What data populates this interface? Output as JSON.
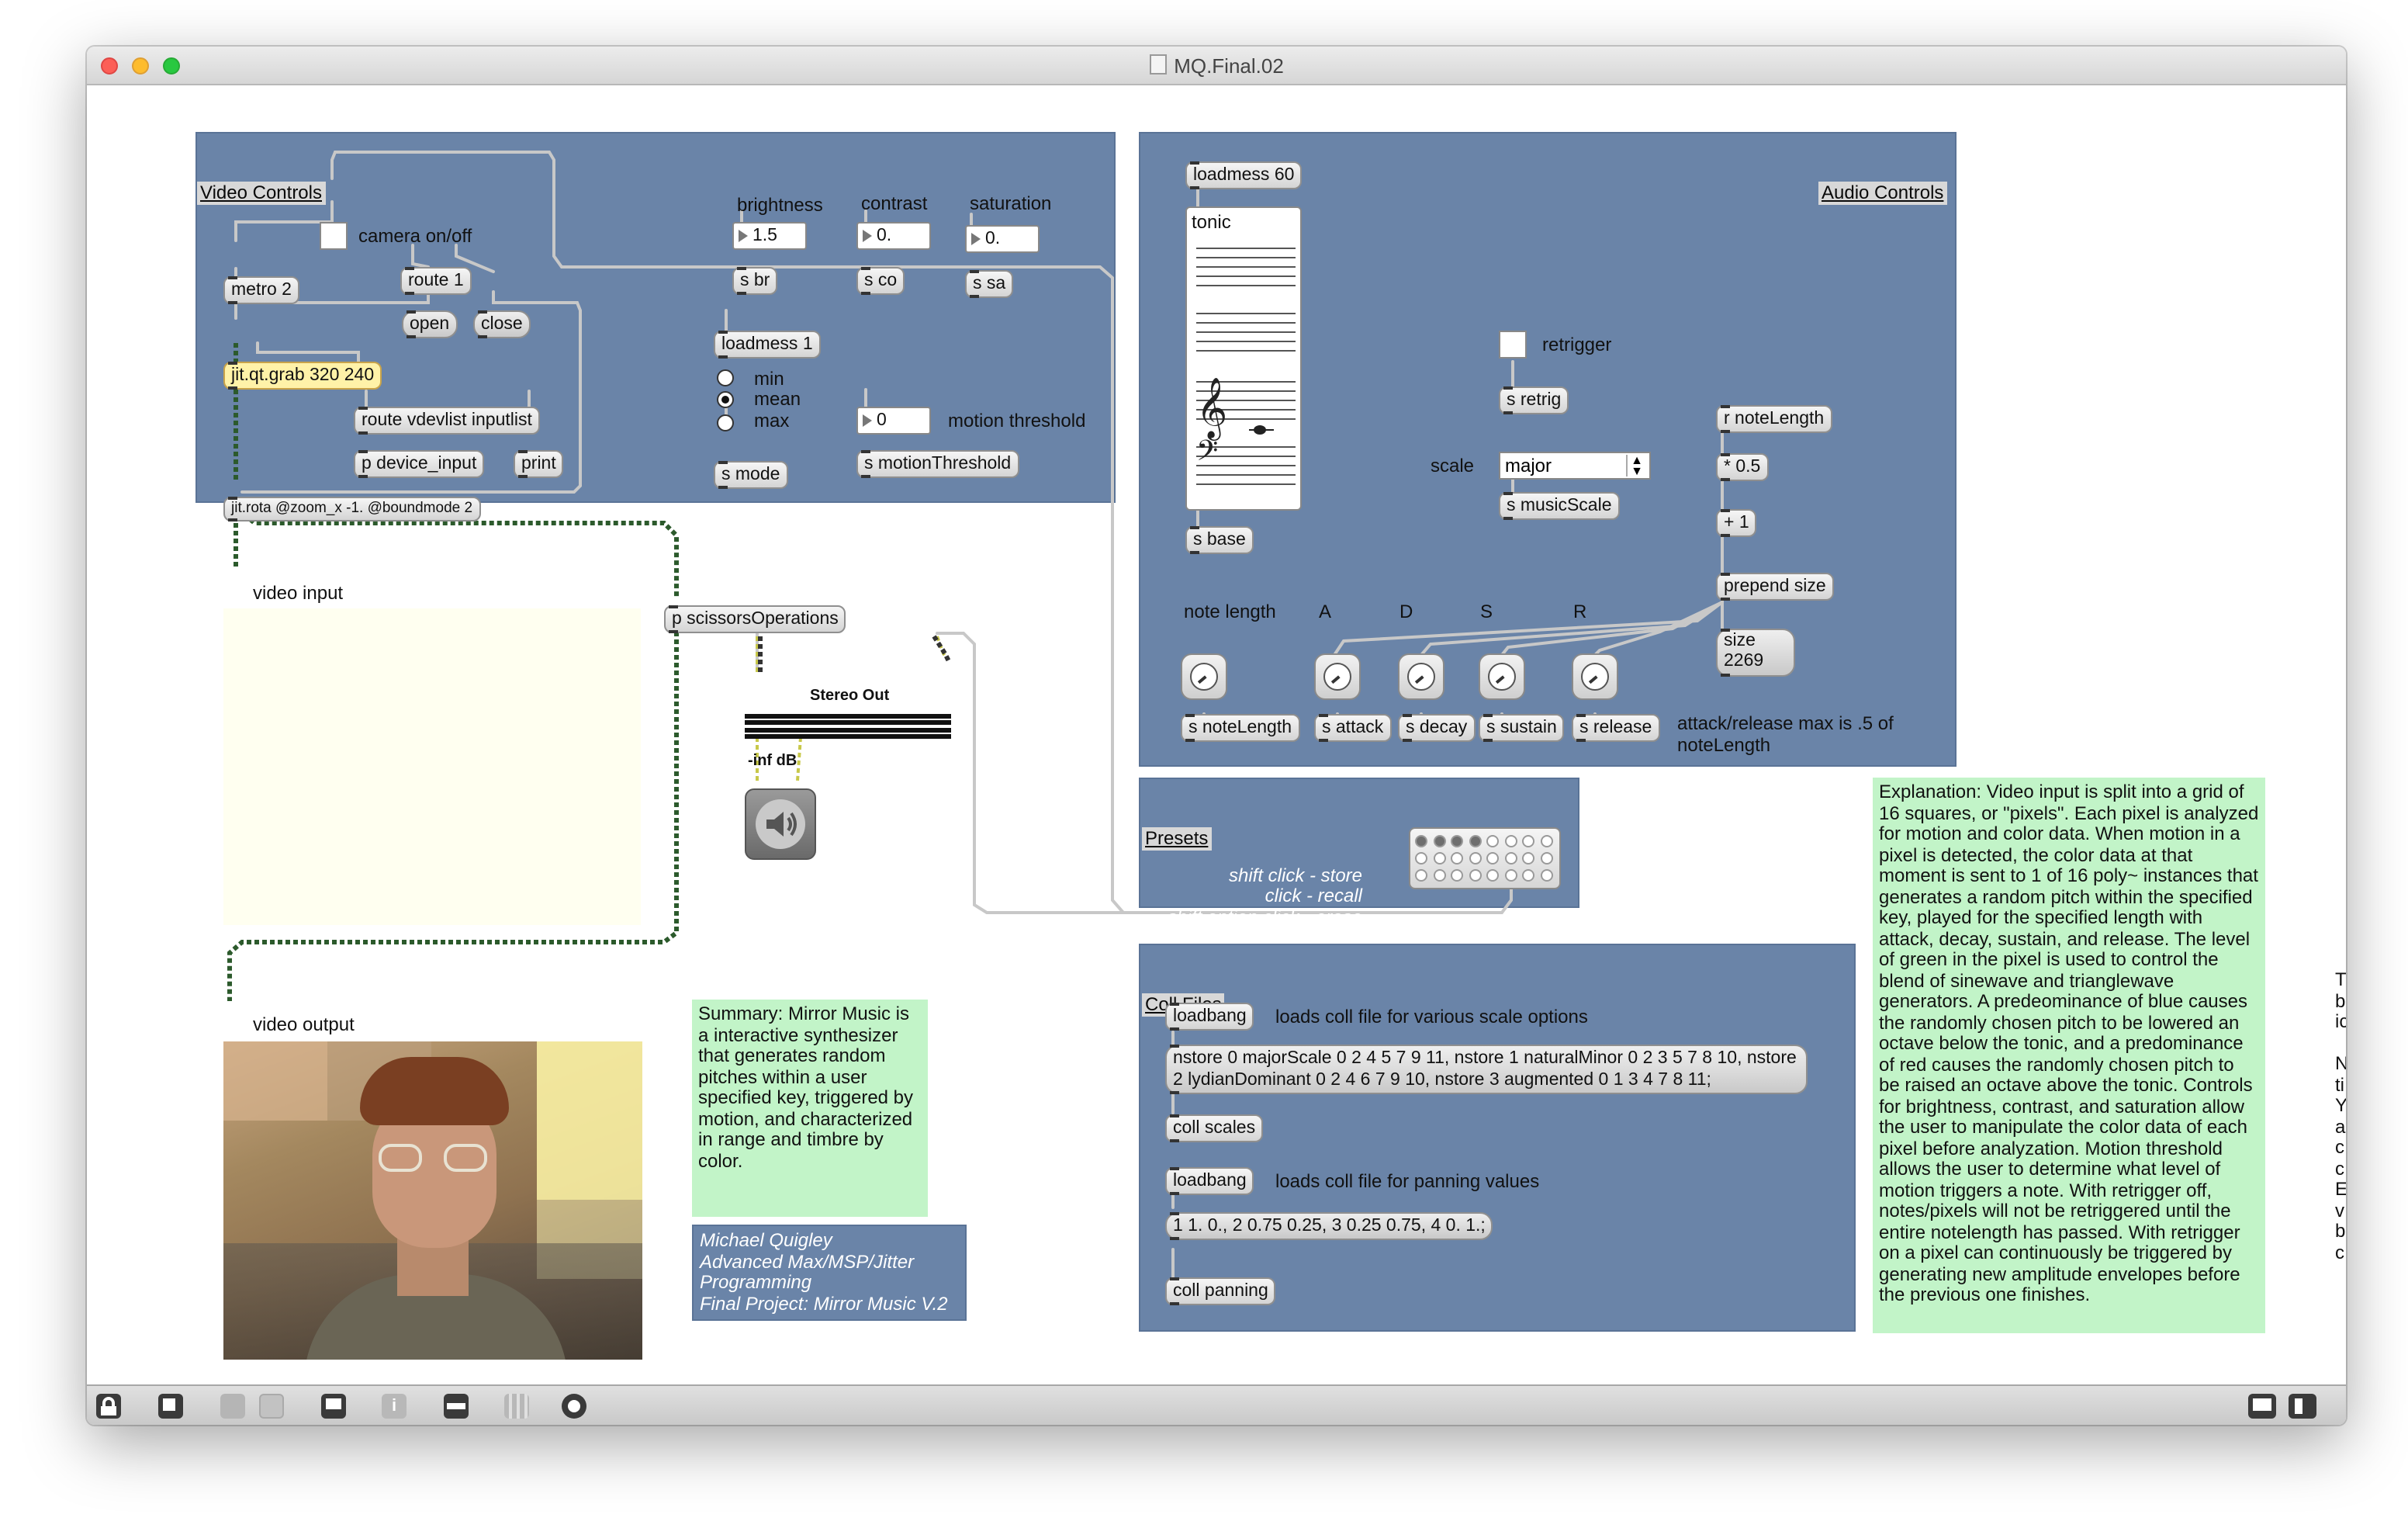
{
  "window": {
    "title": "MQ.Final.02"
  },
  "video_controls": {
    "title": "Video Controls",
    "camera_label": "camera on/off",
    "metro": "metro 2",
    "route1": "route 1",
    "open": "open",
    "close": "close",
    "grab": "jit.qt.grab 320 240",
    "route_vdev": "route vdevlist inputlist",
    "p_device": "p device_input",
    "print": "print",
    "rota": "jit.rota @zoom_x -1. @boundmode 2",
    "brightness_label": "brightness",
    "contrast_label": "contrast",
    "saturation_label": "saturation",
    "brightness_value": "1.5",
    "contrast_value": "0.",
    "saturation_value": "0.",
    "s_br": "s br",
    "s_co": "s co",
    "s_sa": "s sa",
    "loadmess": "loadmess 1",
    "mode_options": [
      "min",
      "mean",
      "max"
    ],
    "mode_selected": "mean",
    "s_mode": "s mode",
    "motion_value": "0",
    "motion_label": "motion threshold",
    "s_motion": "s motionThreshold"
  },
  "video_input_label": "video input",
  "scissors": "p scissorsOperations",
  "stereo": {
    "title": "Stereo Out",
    "level": "-inf dB",
    "icon": "speaker-icon"
  },
  "video_output_label": "video output",
  "summary": "Summary: Mirror Music is a interactive synthesizer that generates random pitches within a user specified key, triggered by motion, and characterized in range and timbre by color.",
  "credits": [
    "Michael Quigley",
    "Advanced Max/MSP/Jitter",
    "Programming",
    "Final Project: Mirror Music V.2"
  ],
  "audio_controls": {
    "title": "Audio Controls",
    "loadmess": "loadmess 60",
    "tonic_label": "tonic",
    "s_base": "s base",
    "retrigger_label": "retrigger",
    "s_retrig": "s retrig",
    "scale_label": "scale",
    "scale_value": "major",
    "s_musicScale": "s musicScale",
    "r_noteLength": "r noteLength",
    "mult": "* 0.5",
    "plus": "+ 1",
    "prepend": "prepend size",
    "size_msg": "size\n2269",
    "note_length_label": "note length",
    "adsr_labels": [
      "A",
      "D",
      "S",
      "R"
    ],
    "sends": [
      "s noteLength",
      "s attack",
      "s decay",
      "s sustain",
      "s release"
    ],
    "attack_note": "attack/release max is .5 of noteLength"
  },
  "presets": {
    "title": "Presets",
    "lines": [
      "shift click - store",
      "click - recall",
      "shift option click - erase"
    ],
    "filled_slots": 4
  },
  "coll_files": {
    "title": "Coll Files",
    "loadbang1": "loadbang",
    "note1": "loads coll file for various scale options",
    "scales_msg": "nstore 0 majorScale 0 2 4 5 7 9 11, nstore 1 naturalMinor 0 2 3 5 7 8 10, nstore 2 lydianDominant 0 2 4 6 7 9 10, nstore 3 augmented 0 1 3 4 7 8 11;",
    "coll_scales": "coll scales",
    "loadbang2": "loadbang",
    "note2": "loads coll file for panning values",
    "pan_msg": "1 1. 0., 2 0.75 0.25, 3 0.25 0.75, 4 0. 1.;",
    "coll_panning": "coll panning"
  },
  "explanation": "Explanation: Video input is split into a grid of 16 squares, or \"pixels\". Each pixel is analyzed for motion and color data. When motion in a pixel is detected, the color data at that moment is sent to 1 of 16 poly~ instances that generates a random pitch within the specified key, played for the specified length with attack, decay, sustain, and release. The level of green in the pixel is used to control the blend of sinewave and trianglewave generators. A predeominance of blue causes the randomly chosen pitch to be lowered an octave below the tonic, and  a predominance of red causes the randomly chosen pitch to be raised an octave above the tonic. Controls for brightness, contrast, and saturation allow the user to manipulate the color data of each pixel before analyzation. Motion threshold allows the user to determine what level of motion triggers a note. With retrigger off, notes/pixels will not be retriggered until the entire notelength has passed. With retrigger on a pixel can continuously be triggered by generating new amplitude envelopes before the previous one finishes.",
  "edge_text": [
    "T",
    "b",
    "ic",
    "",
    "N",
    "ti",
    "Y",
    "a",
    "c",
    "c",
    "E",
    "v",
    "b",
    "c"
  ],
  "toolbar": {
    "left_icons": [
      "lock-icon",
      "presentation-icon",
      "patcher-icon",
      "clear-icon",
      "inspector-icon",
      "info-icon",
      "object-icon",
      "grid-icon",
      "debug-icon"
    ],
    "right_icons": [
      "left-pane-icon",
      "right-pane-icon"
    ]
  }
}
